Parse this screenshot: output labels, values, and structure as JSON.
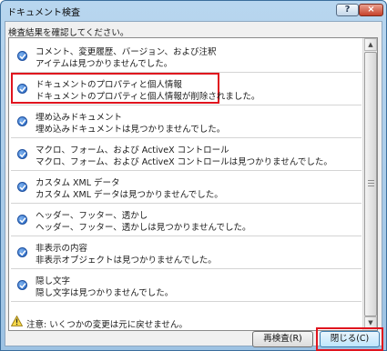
{
  "window": {
    "title": "ドキュメント検査"
  },
  "titlebar": {
    "help_label": "?",
    "close_label": "×"
  },
  "instruction": "検査結果を確認してください。",
  "results": [
    {
      "title": "コメント、変更履歴、バージョン、および注釈",
      "detail": "アイテムは見つかりませんでした。",
      "highlighted": false
    },
    {
      "title": "ドキュメントのプロパティと個人情報",
      "detail": "ドキュメントのプロパティと個人情報が削除されました。",
      "highlighted": true
    },
    {
      "title": "埋め込みドキュメント",
      "detail": "埋め込みドキュメントは見つかりませんでした。",
      "highlighted": false
    },
    {
      "title": "マクロ、フォーム、および ActiveX コントロール",
      "detail": "マクロ、フォーム、および ActiveX コントロールは見つかりませんでした。",
      "highlighted": false
    },
    {
      "title": "カスタム XML データ",
      "detail": "カスタム XML データは見つかりませんでした。",
      "highlighted": false
    },
    {
      "title": "ヘッダー、フッター、透かし",
      "detail": "ヘッダー、フッター、透かしは見つかりませんでした。",
      "highlighted": false
    },
    {
      "title": "非表示の内容",
      "detail": "非表示オブジェクトは見つかりませんでした。",
      "highlighted": false
    },
    {
      "title": "隠し文字",
      "detail": "隠し文字は見つかりませんでした。",
      "highlighted": false
    }
  ],
  "status_icon": "check-icon",
  "scrollbar": {
    "up_arrow": "▲",
    "down_arrow": "▼"
  },
  "warning": {
    "icon": "warning-icon",
    "text": "注意: いくつかの変更は元に戻せません。"
  },
  "buttons": {
    "reinspect": "再検査(R)",
    "close": "閉じる(C)"
  },
  "colors": {
    "highlight": "#e0141e",
    "check": "#1f5fbf",
    "titlebar": "#b8d6ef"
  }
}
